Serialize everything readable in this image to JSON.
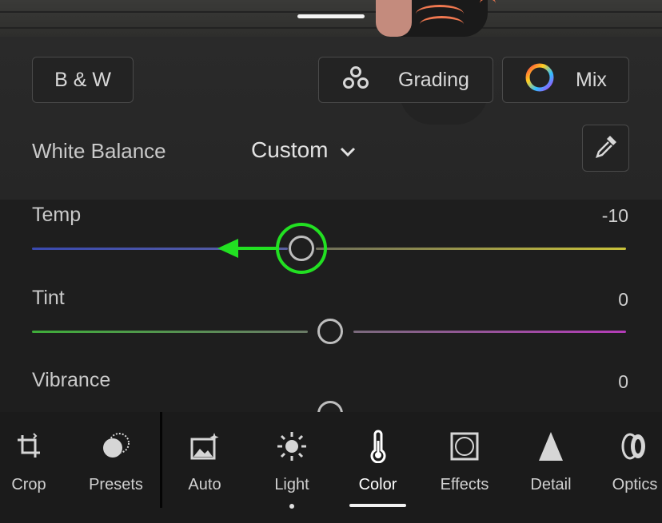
{
  "buttons": {
    "bw_label": "B & W",
    "grading_label": "Grading",
    "mix_label": "Mix"
  },
  "white_balance": {
    "label": "White Balance",
    "value": "Custom"
  },
  "sliders": [
    {
      "label": "Temp",
      "value": "-10",
      "position": 0.45
    },
    {
      "label": "Tint",
      "value": "0",
      "position": 0.5
    },
    {
      "label": "Vibrance",
      "value": "0",
      "position": 0.5
    }
  ],
  "toolbar": {
    "items": [
      {
        "label": "Crop",
        "icon": "crop-icon"
      },
      {
        "label": "Presets",
        "icon": "presets-icon"
      },
      {
        "label": "Auto",
        "icon": "auto-icon"
      },
      {
        "label": "Light",
        "icon": "light-icon"
      },
      {
        "label": "Color",
        "icon": "thermometer-icon"
      },
      {
        "label": "Effects",
        "icon": "effects-icon"
      },
      {
        "label": "Detail",
        "icon": "detail-icon"
      },
      {
        "label": "Optics",
        "icon": "optics-icon"
      }
    ],
    "active": "Color"
  },
  "colors": {
    "annotation": "#22e022",
    "temp_gradient": [
      "#3a4ab0",
      "#c9c23a"
    ],
    "tint_gradient": [
      "#3fae3a",
      "#b43cb8"
    ]
  }
}
